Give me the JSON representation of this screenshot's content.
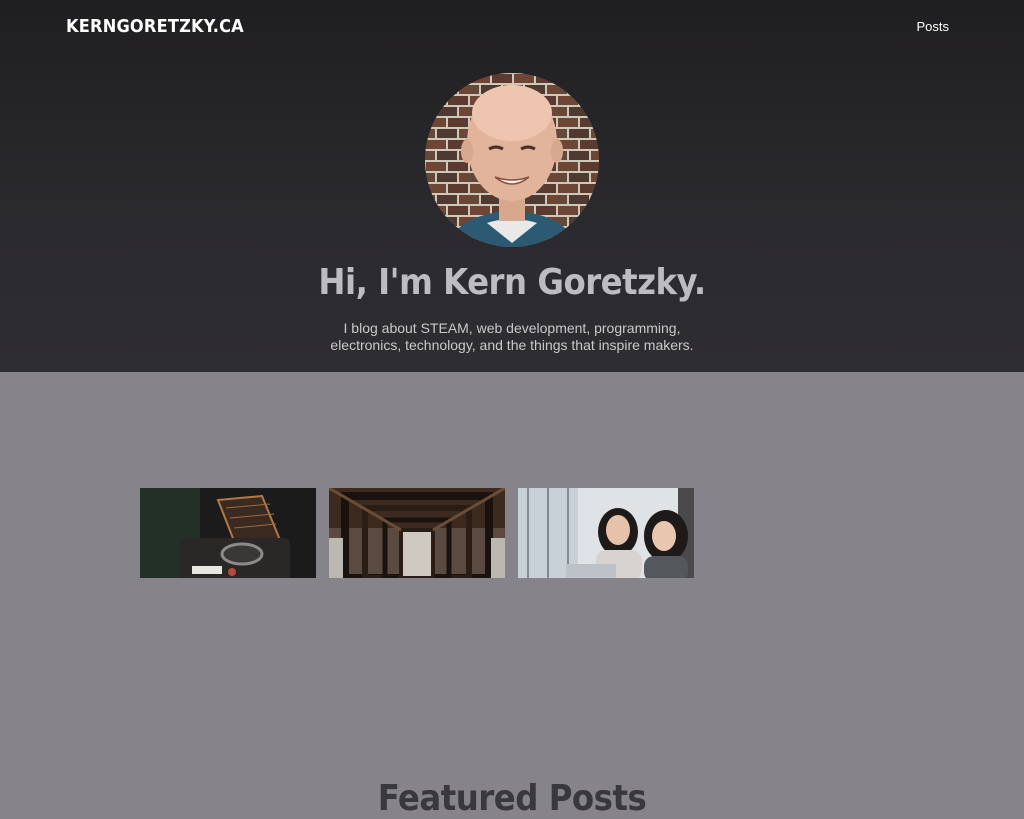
{
  "header": {
    "site_title": "KERNGORETZKY.CA",
    "nav": [
      {
        "label": "Posts"
      }
    ]
  },
  "hero": {
    "avatar_icon": "portrait-photo",
    "heading": "Hi, I'm Kern Goretzky.",
    "tagline_line1": "I blog about STEAM, web development, programming,",
    "tagline_line2": "electronics, technology, and the things that inspire makers."
  },
  "featured": {
    "heading": "Featured Posts",
    "posts": [
      {
        "image": "electronic-device-photo"
      },
      {
        "image": "symmetric-architecture-photo"
      },
      {
        "image": "two-women-laptop-photo"
      }
    ]
  },
  "colors": {
    "hero_bg": "#2b2a2e",
    "featured_bg": "#86848a",
    "hero_heading": "#bcbcc2",
    "featured_heading": "#39383c"
  }
}
